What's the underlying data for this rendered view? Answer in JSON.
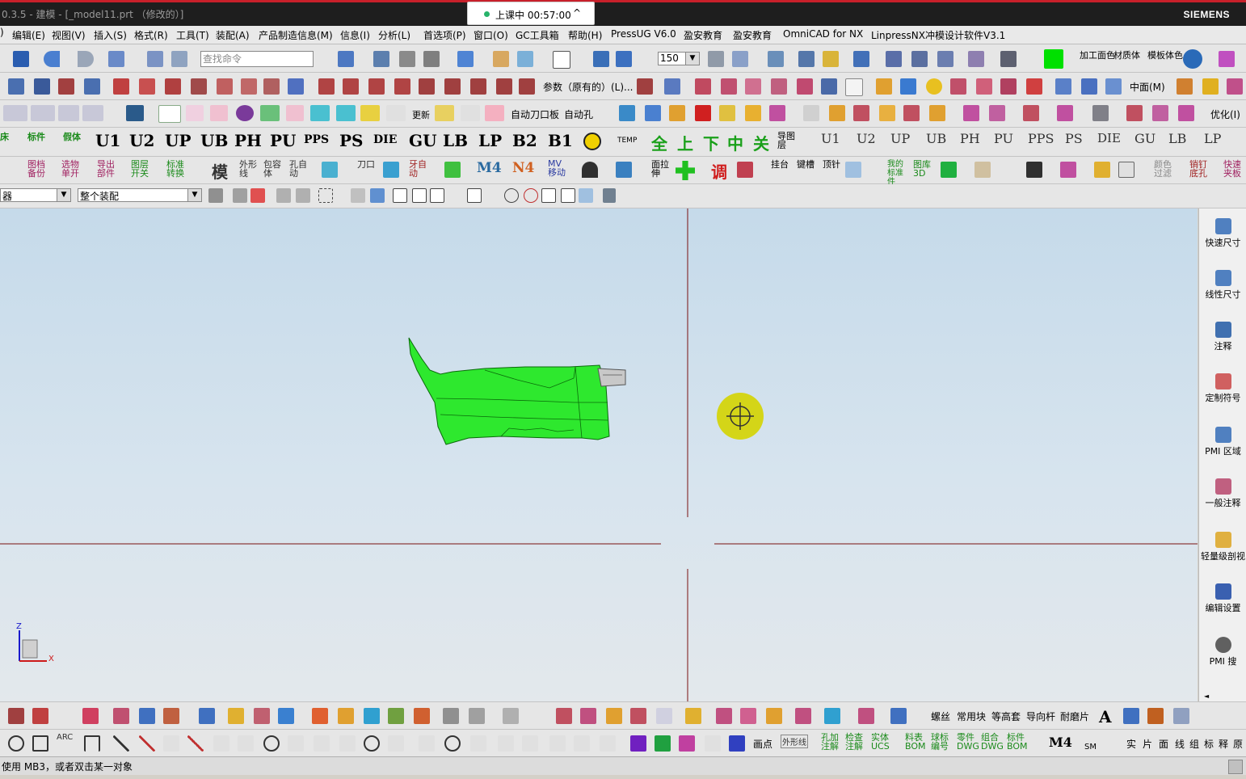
{
  "window": {
    "title": "0.3.5 - 建模 - [_model11.prt （修改的）]",
    "brand": "SIEMENS"
  },
  "class_timer": {
    "label": "上课中 00:57:00"
  },
  "menu": {
    "items": [
      "编辑(E)",
      "视图(V)",
      "插入(S)",
      "格式(R)",
      "工具(T)",
      "装配(A)",
      "产品制造信息(M)",
      "信息(I)",
      "分析(L)",
      "首选项(P)",
      "窗口(O)",
      "GC工具箱",
      "帮助(H)",
      "PressUG V6.0",
      "盈安教育",
      "盈安教育",
      "OmniCAD for NX",
      "LinpressNX冲模设计软件V3.1"
    ]
  },
  "toolbar1": {
    "search_placeholder": "查找命令",
    "zoom_value": "150",
    "labels": [
      "加工面色",
      "材质体",
      "模板体色"
    ]
  },
  "toolbar2": {
    "param_label": "参数（原有的）(L)...",
    "midplane_label": "中面(M)"
  },
  "toolbar3": {
    "auto_knife": "自动刀口板",
    "auto_hole": "自动孔",
    "update": "更新",
    "optimize": "优化(I)"
  },
  "toolbar4": {
    "big_labels": [
      "U1",
      "U2",
      "UP",
      "UB",
      "PH",
      "PU",
      "PPS",
      "PS",
      "DIE",
      "GU",
      "LB",
      "LP",
      "B2",
      "B1"
    ],
    "chinese": [
      "全",
      "上",
      "下",
      "中",
      "关"
    ],
    "small_labels": [
      "U1",
      "U2",
      "UP",
      "UB",
      "PH",
      "PU",
      "PPS",
      "PS",
      "DIE",
      "GU",
      "LB",
      "LP"
    ],
    "guide_label": "导图层"
  },
  "toolbar5": {
    "labels": [
      "图档备份",
      "选物单开",
      "导出部件",
      "图层开关",
      "标准转换",
      "模",
      "外形线",
      "包容体",
      "孔自动",
      "刀口",
      "牙自动",
      "M4",
      "N4",
      "MV移动",
      "面拉伸",
      "调",
      "挂台",
      "键槽",
      "顶针",
      "我的标准件",
      "图库3D",
      "颜色过滤",
      "销钉底孔",
      "快速夹板"
    ]
  },
  "selection_bar": {
    "filter_value": "器",
    "assembly_value": "整个装配"
  },
  "right_panel": {
    "items": [
      "快速尺寸",
      "线性尺寸",
      "注释",
      "定制符号",
      "PMI 区域",
      "一般注释",
      "轻量级剖视",
      "编辑设置",
      "PMI 搜"
    ]
  },
  "bottom_toolbar": {
    "row1_labels": [
      "螺丝",
      "常用块",
      "等高套",
      "导向杆",
      "耐磨片"
    ],
    "row2_labels": [
      "画点",
      "外形线",
      "孔加注解",
      "检查注解",
      "实体UCS",
      "料表BOM",
      "球标编号",
      "零件DWG",
      "组合DWG",
      "标件BOM",
      "M4",
      "SM",
      "实",
      "片",
      "面",
      "线",
      "组",
      "标",
      "释",
      "原"
    ]
  },
  "status": {
    "text": "使用 MB3，或者双击某一对象"
  },
  "axis": {
    "z": "Z",
    "x": "X"
  },
  "colors": {
    "part_green": "#2ee82e",
    "crosshair_line": "#7a1010",
    "cursor_circle": "#d4d400",
    "titlebar_bg": "#1e1e1e"
  }
}
